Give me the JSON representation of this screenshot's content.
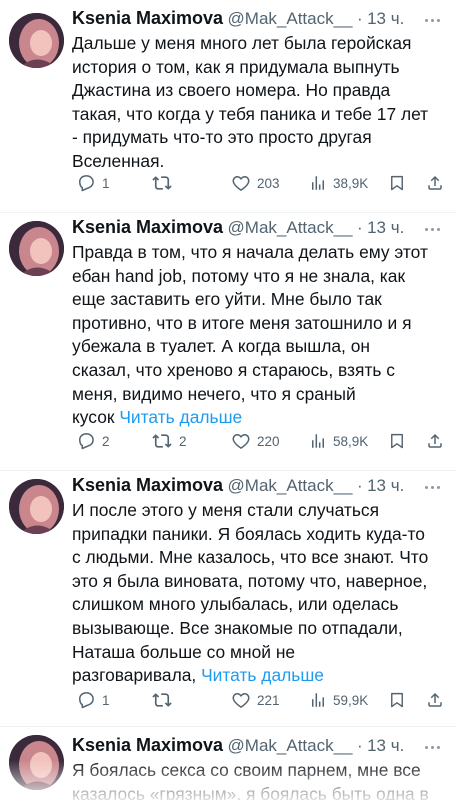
{
  "tweets": [
    {
      "author": {
        "name": "Ksenia Maximova",
        "handle": "@Mak_Attack__",
        "dot": "·",
        "time": "13 ч."
      },
      "lines": [
        "Дальше у меня много лет была геройская",
        "история о том, как я придумала выпнуть",
        "Джастина из своего номера. Но правда",
        "такая, что когда у тебя паника и тебе 17 лет",
        "- придумать что-то это просто другая",
        "Вселенная."
      ],
      "last_line_text": "",
      "read_more": "",
      "stats": {
        "replies": "1",
        "retweets": "",
        "likes": "203",
        "views": "38,9K"
      }
    },
    {
      "author": {
        "name": "Ksenia Maximova",
        "handle": "@Mak_Attack__",
        "dot": "·",
        "time": "13 ч."
      },
      "lines": [
        "Правда в том, что я начала делать ему этот",
        "ебан hand job, потому что я не знала, как",
        "еще заставить его уйти. Мне было так",
        "противно, что в итоге меня затошнило и я",
        "убежала в туалет. А когда вышла, он",
        "сказал, что хреново я стараюсь, взять с",
        "меня, видимо нечего, что я сраный"
      ],
      "last_line_text": "кусок",
      "read_more": "Читать дальше",
      "stats": {
        "replies": "2",
        "retweets": "2",
        "likes": "220",
        "views": "58,9K"
      }
    },
    {
      "author": {
        "name": "Ksenia Maximova",
        "handle": "@Mak_Attack__",
        "dot": "·",
        "time": "13 ч."
      },
      "lines": [
        "И после этого у меня стали случаться",
        "припадки паники. Я боялась ходить куда-то",
        "с людьми. Мне казалось, что все знают. Что",
        "это я была виновата, потому что, наверное,",
        "слишком много улыбалась, или оделась",
        "вызывающе. Все знакомые по отпадали,",
        "Наташа больше со мной не"
      ],
      "last_line_text": "разговаривала,",
      "read_more": "Читать дальше",
      "stats": {
        "replies": "1",
        "retweets": "",
        "likes": "221",
        "views": "59,9K"
      }
    },
    {
      "author": {
        "name": "Ksenia Maximova",
        "handle": "@Mak_Attack__",
        "dot": "·",
        "time": "13 ч."
      },
      "lines": [
        "Я боялась секса со своим парнем, мне все",
        "казалось «грязным», я боялась быть одна в"
      ],
      "last_line_text": "",
      "read_more": "",
      "stats": null
    }
  ],
  "icons": {
    "reply": "reply-icon",
    "retweet": "retweet-icon",
    "like": "heart-icon",
    "views": "views-icon",
    "bookmark": "bookmark-icon",
    "share": "share-icon",
    "more": "more-icon"
  },
  "colors": {
    "text": "#0f1419",
    "secondary": "#536471",
    "link": "#1d9bf0",
    "separator": "#eff3f4"
  }
}
